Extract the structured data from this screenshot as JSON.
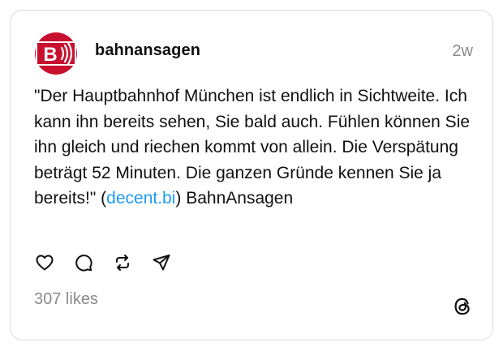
{
  "post": {
    "username": "bahnansagen",
    "timestamp": "2w",
    "text_before_link": "\"Der Hauptbahnhof München ist endlich in Sichtweite. Ich kann ihn bereits sehen, Sie bald auch. Fühlen können Sie ihn gleich und riechen kommt von allein. Die Verspätung beträgt 52 Minuten. Die ganzen Gründe kennen Sie ja bereits!\" (",
    "link_text": "decent.bi",
    "text_after_link": ") BahnAnsagen",
    "likes_label": "307 likes"
  },
  "avatar": {
    "letter": "B",
    "bg_color": "#c8102e",
    "fg_color": "#ffffff"
  },
  "actions": {
    "icons": [
      "heart-icon",
      "comment-icon",
      "repost-icon",
      "share-icon"
    ]
  },
  "brand": {
    "logo": "threads-logo-icon"
  },
  "colors": {
    "link": "#1d9bf0",
    "muted": "#8a8a8a",
    "text": "#101010",
    "border": "#d9d9d9"
  }
}
